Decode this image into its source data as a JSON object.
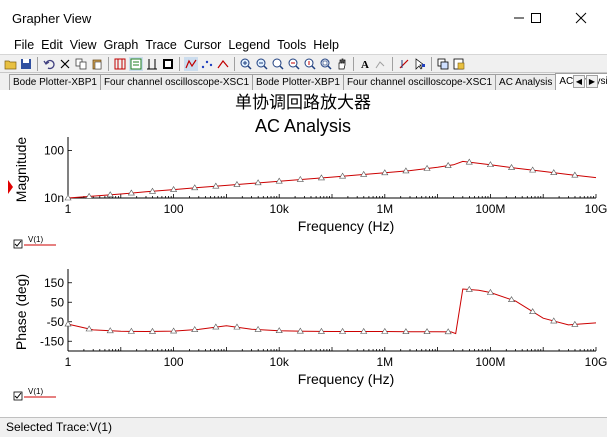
{
  "window": {
    "title": "Grapher View"
  },
  "menu": [
    "File",
    "Edit",
    "View",
    "Graph",
    "Trace",
    "Cursor",
    "Legend",
    "Tools",
    "Help"
  ],
  "tabs": [
    {
      "label": "Bode Plotter-XBP1",
      "active": false
    },
    {
      "label": "Four channel oscilloscope-XSC1",
      "active": false
    },
    {
      "label": "Bode Plotter-XBP1",
      "active": false
    },
    {
      "label": "Four channel oscilloscope-XSC1",
      "active": false
    },
    {
      "label": "AC Analysis",
      "active": false
    },
    {
      "label": "AC Analysi",
      "active": true
    }
  ],
  "graph": {
    "title_cn": "单协调回路放大器",
    "title": "AC Analysis"
  },
  "chart_data": [
    {
      "type": "line",
      "title": "AC Analysis",
      "xlabel": "Frequency (Hz)",
      "ylabel": "Magnitude",
      "x_scale": "log",
      "y_scale": "log",
      "xlim": [
        1,
        10000000000
      ],
      "ylim": [
        1e-08,
        10000
      ],
      "x_ticks": [
        1,
        100,
        10000,
        1000000,
        100000000,
        10000000000
      ],
      "x_tick_labels": [
        "1",
        "100",
        "10k",
        "1M",
        "100M",
        "10G"
      ],
      "y_ticks": [
        1e-08,
        100
      ],
      "y_tick_labels": [
        "10n",
        "100"
      ],
      "legend": "V(1)",
      "series": [
        {
          "name": "V(1)",
          "color": "#cc0000",
          "x": [
            1,
            3,
            10,
            30,
            100,
            300,
            1000,
            3000,
            10000,
            30000,
            100000,
            300000,
            1000000,
            3000000,
            10000000,
            20000000,
            30000000,
            100000000,
            300000000,
            1000000000,
            3000000000,
            10000000000
          ],
          "y": [
            1e-08,
            2.5e-08,
            7e-08,
            2e-07,
            6e-07,
            1.6e-06,
            4.5e-06,
            1.2e-05,
            3.5e-05,
            9e-05,
            0.00025,
            0.0007,
            0.002,
            0.006,
            0.03,
            0.1,
            0.5,
            0.1,
            0.02,
            0.004,
            0.0009,
            0.0002
          ]
        }
      ]
    },
    {
      "type": "line",
      "xlabel": "Frequency (Hz)",
      "ylabel": "Phase (deg)",
      "x_scale": "log",
      "xlim": [
        1,
        10000000000
      ],
      "ylim": [
        -200,
        200
      ],
      "x_ticks": [
        1,
        100,
        10000,
        1000000,
        100000000,
        10000000000
      ],
      "x_tick_labels": [
        "1",
        "100",
        "10k",
        "1M",
        "100M",
        "10G"
      ],
      "y_ticks": [
        150,
        50,
        -50,
        -150
      ],
      "y_tick_labels": [
        "150",
        "50",
        "-50",
        "-150"
      ],
      "legend": "V(1)",
      "series": [
        {
          "name": "V(1)",
          "color": "#cc0000",
          "x": [
            1,
            3,
            10,
            30,
            100,
            300,
            1000,
            3000,
            10000,
            30000,
            100000,
            300000,
            1000000,
            3000000,
            10000000,
            18000000,
            22000000,
            30000000,
            60000000,
            100000000,
            300000000,
            1000000000,
            3000000000,
            10000000000
          ],
          "y": [
            -62,
            -92,
            -99,
            -100,
            -98,
            -89,
            -70,
            -88,
            -96,
            -99,
            -100,
            -100,
            -100,
            -101,
            -101,
            -102,
            -111,
            118,
            112,
            100,
            56,
            -32,
            -66,
            -56
          ]
        }
      ]
    }
  ],
  "status": {
    "text": "Selected Trace:V(1)"
  }
}
